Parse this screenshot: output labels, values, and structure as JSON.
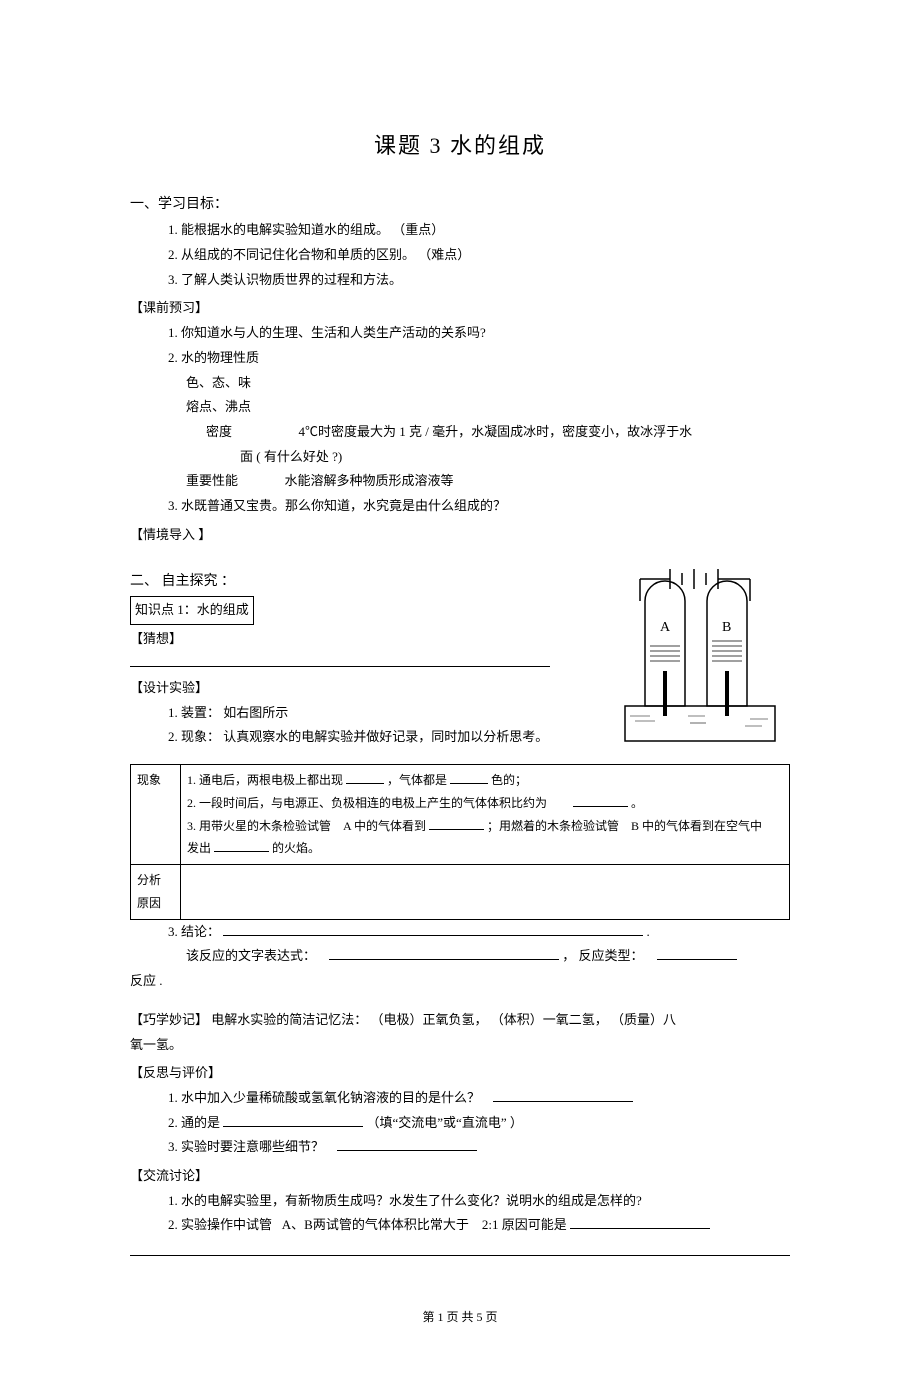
{
  "title": "课题 3 水的组成",
  "section1": {
    "head": "一、学习目标：",
    "items": [
      "1. 能根据水的电解实验知道水的组成。  （重点）",
      "2. 从组成的不同记住化合物和单质的区别。  （难点）",
      "3. 了解人类认识物质世界的过程和方法。"
    ]
  },
  "prestudy": {
    "head": "【课前预习】",
    "q1": "1. 你知道水与人的生理、生活和人类生产活动的关系吗?",
    "q2": "2. 水的物理性质",
    "p21": "色、态、味",
    "p22": "熔点、沸点",
    "p23_a": "密度",
    "p23_b": "4℃时密度最大为   1 克 / 毫升，水凝固成冰时，密度变小，故冰浮于水",
    "p23_c": "面 ( 有什么好处  ?)",
    "p24_a": "重要性能",
    "p24_b": "水能溶解多种物质形成溶液等",
    "q3": "3. 水既普通又宝贵。那么你知道，水究竟是由什么组成的？"
  },
  "context": {
    "head": "【情境导入 】"
  },
  "section2": {
    "head": "二、 自主探究 ：",
    "kp1": "知识点  1：水的组成",
    "guess": "【猜想】",
    "design": "【设计实验】",
    "d1": "1. 装置：  如右图所示",
    "d2": "2. 现象：  认真观察水的电解实验并做好记录，同时加以分析思考。"
  },
  "table": {
    "row1_label": "现象",
    "row1_l1_a": "1. 通电后，两根电极上都出现",
    "row1_l1_b": "，气体都是",
    "row1_l1_c": "色的；",
    "row1_l2_a": "2. 一段时间后，与电源正、负极相连的电极上产生的气体体积比约为",
    "row1_l2_b": "。",
    "row1_l3_a": "3. 用带火星的木条检验试管",
    "row1_l3_b": "A 中的气体看到",
    "row1_l3_c": "；用燃着的木条检验试管",
    "row1_l3_d": "B 中的气体看到在空气中",
    "row1_l4_a": "发出",
    "row1_l4_b": "的火焰。",
    "row2_label": "分析\n原因"
  },
  "conclusion": {
    "l1_a": "3. 结论：",
    "l1_b": ".",
    "l2_a": "该反应的文字表达式：",
    "l2_b": "，   反应类型：",
    "l3": "反应 ."
  },
  "mnemonic": {
    "a": "【巧学妙记】   电解水实验的简洁记忆法：  （电极）正氧负氢，  （体积）一氧二氢，  （质量）八",
    "b": "氧一氢。"
  },
  "reflect": {
    "head": "【反思与评价】",
    "q1": "1. 水中加入少量稀硫酸或氢氧化钠溶液的目的是什么？",
    "q2_a": "2. 通的是",
    "q2_b": "（填“交流电”或“直流电”  ）",
    "q3": "3. 实验时要注意哪些细节？"
  },
  "discuss": {
    "head": "【交流讨论】",
    "q1": "1. 水的电解实验里，有新物质生成吗？水发生了什么变化？说明水的组成是怎样的?",
    "q2_a": "2. 实验操作中试管",
    "q2_b": "A、B两试管的气体体积比常大于",
    "q2_c": "2:1 原因可能是"
  },
  "footer": "第 1 页 共 5 页"
}
